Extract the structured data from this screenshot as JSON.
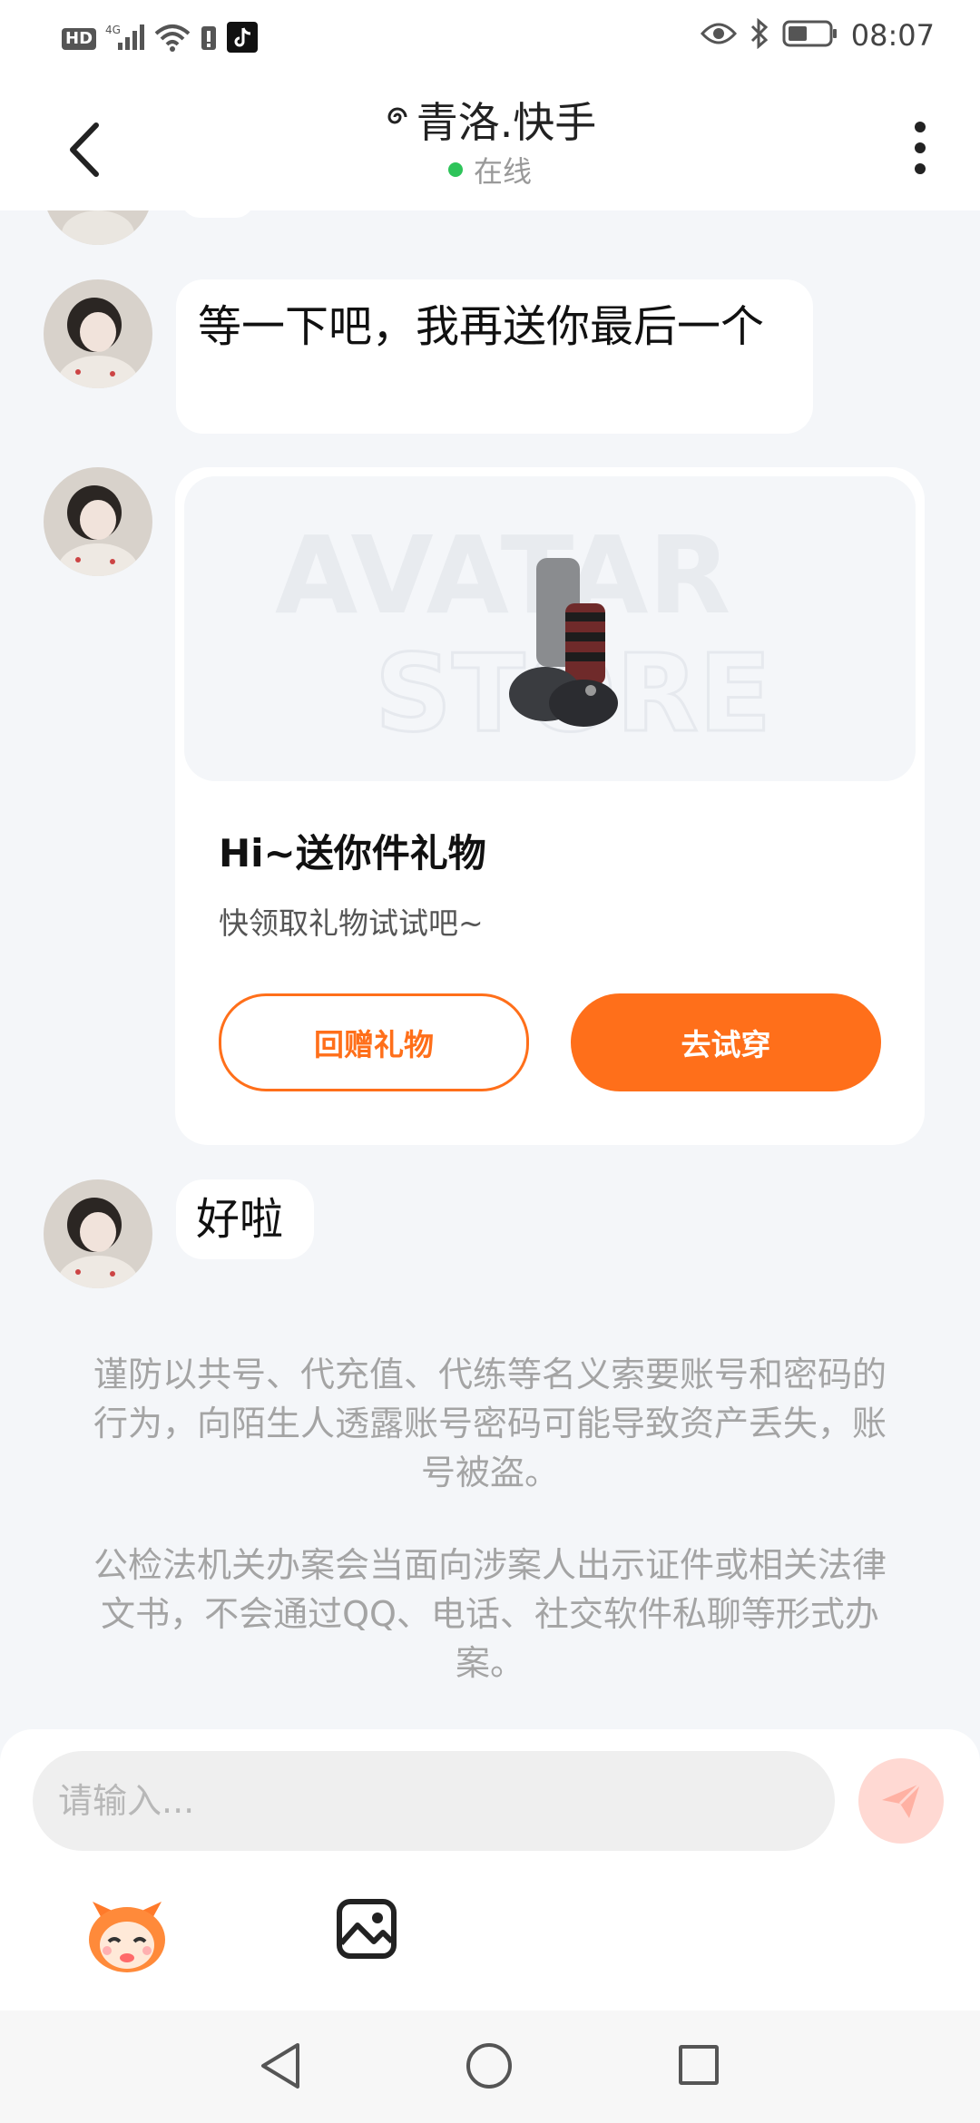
{
  "status_bar": {
    "hd_label": "HD",
    "network_label": "4G",
    "time": "08:07"
  },
  "header": {
    "title": "青洛.快手",
    "title_prefix_icon": "swirl-icon",
    "status": "在线"
  },
  "messages": [
    {
      "type": "text",
      "from": "peer",
      "text": "等一下吧，我再送你最后一个"
    },
    {
      "type": "gift_card",
      "from": "peer",
      "title": "Hi~送你件礼物",
      "subtitle": "快领取礼物试试吧~",
      "watermark_line1": "AVATAR",
      "watermark_line2": "STORE",
      "button_return": "回赠礼物",
      "button_try": "去试穿"
    },
    {
      "type": "text",
      "from": "peer",
      "text": "好啦"
    }
  ],
  "notices": [
    "谨防以共号、代充值、代练等名义索要账号和密码的行为，向陌生人透露账号密码可能导致资产丢失，账号被盗。",
    "公检法机关办案会当面向涉案人出示证件或相关法律文书，不会通过QQ、电话、社交软件私聊等形式办案。"
  ],
  "composer": {
    "placeholder": "请输入...",
    "send_icon": "paper-plane-icon",
    "emoji_icon": "mascot-icon",
    "image_icon": "gallery-icon"
  },
  "colors": {
    "accent": "#ff6f1a",
    "online": "#2ec45a",
    "background": "#f4f6f9",
    "send_disabled": "#ffd9d3"
  }
}
